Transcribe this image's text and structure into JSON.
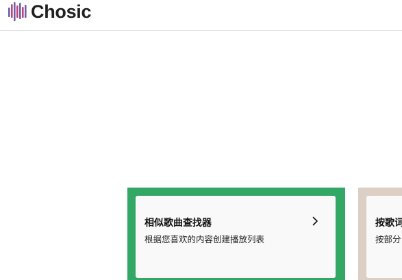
{
  "brand": {
    "name": "Chosic",
    "logo_icon": "waveform-bars-icon",
    "colors": {
      "bar_primary": "#6b5fa8",
      "bar_secondary": "#c0457a"
    }
  },
  "cards": [
    {
      "title": "相似歌曲查找器",
      "description": "根据您喜欢的内容创建播放列表",
      "icon": "chevron-right-icon",
      "frame_color": "#33a866"
    },
    {
      "title": "按歌词",
      "description": "按部分",
      "frame_color": "#dccfc6"
    }
  ]
}
